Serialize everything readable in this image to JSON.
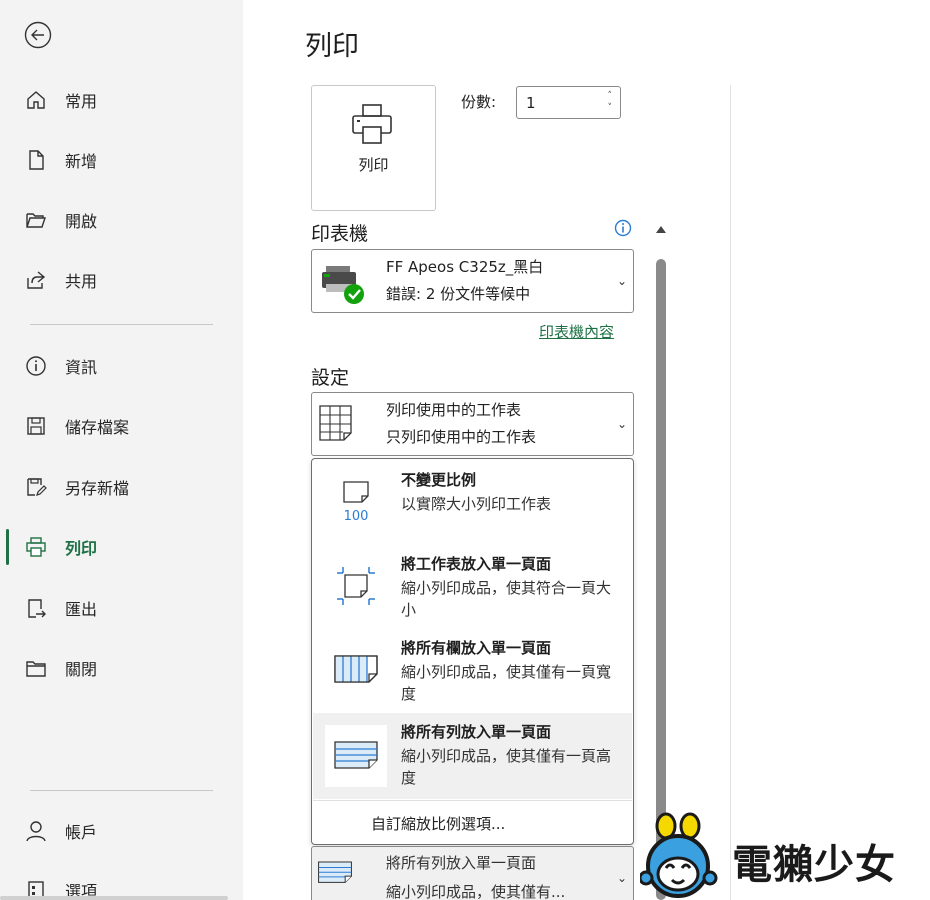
{
  "sidebar": {
    "back_icon": "circle-arrow-left-icon",
    "items": [
      {
        "label": "常用",
        "icon": "home-icon"
      },
      {
        "label": "新增",
        "icon": "new-document-icon"
      },
      {
        "label": "開啟",
        "icon": "open-folder-icon"
      },
      {
        "label": "共用",
        "icon": "share-icon"
      },
      {
        "label": "資訊",
        "icon": "info-icon"
      },
      {
        "label": "儲存檔案",
        "icon": "save-icon"
      },
      {
        "label": "另存新檔",
        "icon": "save-as-icon"
      },
      {
        "label": "列印",
        "icon": "printer-icon",
        "active": true
      },
      {
        "label": "匯出",
        "icon": "export-icon"
      },
      {
        "label": "關閉",
        "icon": "close-folder-icon"
      },
      {
        "label": "帳戶",
        "icon": "account-icon"
      },
      {
        "label": "選項",
        "icon": "options-icon"
      }
    ]
  },
  "main": {
    "title": "列印",
    "print_button_label": "列印",
    "copies_label": "份數:",
    "copies_value": "1",
    "printer_section_title": "印表機",
    "printer": {
      "name": "FF Apeos C325z_黑白",
      "status": "錯誤: 2 份文件等候中"
    },
    "printer_properties_link": "印表機內容",
    "settings_section_title": "設定",
    "settings_dropdown": {
      "title": "列印使用中的工作表",
      "subtitle": "只列印使用中的工作表"
    },
    "scaling_menu": {
      "options": [
        {
          "title": "不變更比例",
          "desc": "以實際大小列印工作表",
          "icon": "no-scaling-icon"
        },
        {
          "title": "將工作表放入單一頁面",
          "desc": "縮小列印成品，使其符合一頁大小",
          "icon": "fit-sheet-icon"
        },
        {
          "title": "將所有欄放入單一頁面",
          "desc": "縮小列印成品，使其僅有一頁寬度",
          "icon": "fit-columns-icon"
        },
        {
          "title": "將所有列放入單一頁面",
          "desc": "縮小列印成品，使其僅有一頁高度",
          "icon": "fit-rows-icon",
          "highlighted": true
        }
      ],
      "custom_option": "自訂縮放比例選項..."
    },
    "scaling_dropdown": {
      "title": "將所有列放入單一頁面",
      "subtitle": "縮小列印成品，使其僅有..."
    }
  },
  "watermark": {
    "text": "電獺少女"
  },
  "colors": {
    "accent": "#1e7145",
    "sidebar_bg": "#f3f3f3",
    "icon_blue": "#2b7cd3",
    "check_green": "#13a10e"
  }
}
